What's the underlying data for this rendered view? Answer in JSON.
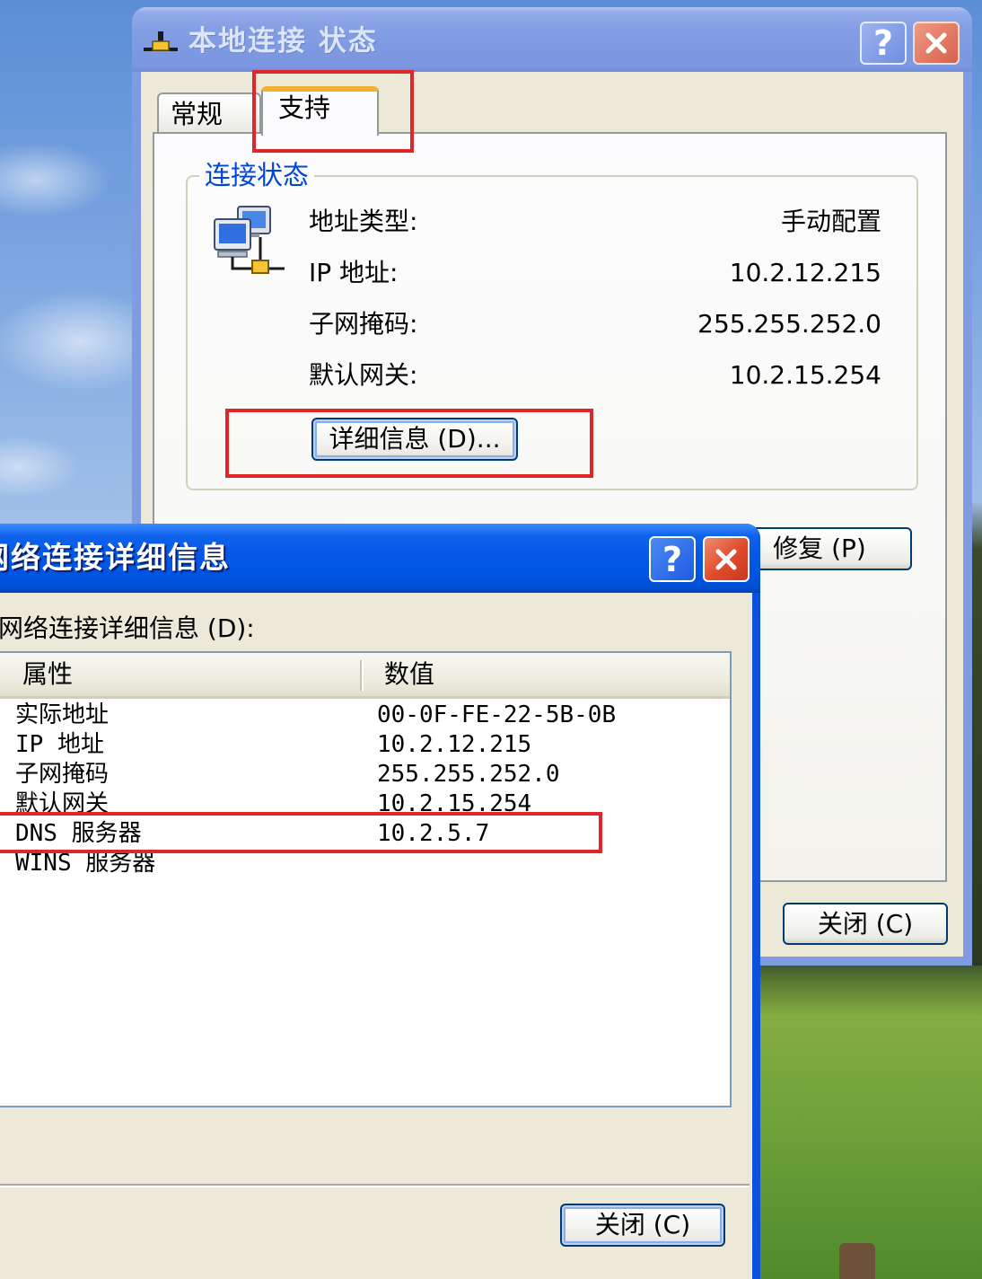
{
  "status_window": {
    "title": "本地连接 状态",
    "help_glyph": "?",
    "tabs": [
      {
        "label": "常规",
        "selected": false
      },
      {
        "label": "支持",
        "selected": true
      }
    ],
    "connection_status": {
      "group_title": "连接状态",
      "rows": [
        {
          "label": "地址类型:",
          "value": "手动配置"
        },
        {
          "label": "IP 地址:",
          "value": "10.2.12.215"
        },
        {
          "label": "子网掩码:",
          "value": "255.255.252.0"
        },
        {
          "label": "默认网关:",
          "value": "10.2.15.254"
        }
      ],
      "details_button": "详细信息 (D)..."
    },
    "repair_button": "修复 (P)",
    "close_button": "关闭 (C)"
  },
  "details_window": {
    "title": "网络连接详细信息",
    "help_glyph": "?",
    "list_label": "网络连接详细信息 (D):",
    "columns": [
      {
        "label": "属性"
      },
      {
        "label": "数值"
      }
    ],
    "rows": [
      {
        "property": "实际地址",
        "value": "00-0F-FE-22-5B-0B"
      },
      {
        "property": "IP 地址",
        "value": "10.2.12.215"
      },
      {
        "property": "子网掩码",
        "value": "255.255.252.0"
      },
      {
        "property": "默认网关",
        "value": "10.2.15.254"
      },
      {
        "property": "DNS 服务器",
        "value": "10.2.5.7"
      },
      {
        "property": "WINS 服务器",
        "value": ""
      }
    ],
    "close_button": "关闭 (C)"
  },
  "icons": {
    "status_window_title": "network-connection-icon",
    "connection_status": "network-computers-icon",
    "help": "help-icon",
    "close": "close-icon"
  },
  "colors": {
    "dialog_face": "#ECE9D8",
    "group_title": "#0046D5",
    "annotation_red": "#E0262B",
    "selected_tab_accent": "#F5B133",
    "close_button_red": "#E04A2B",
    "button_border": "#003C74"
  }
}
